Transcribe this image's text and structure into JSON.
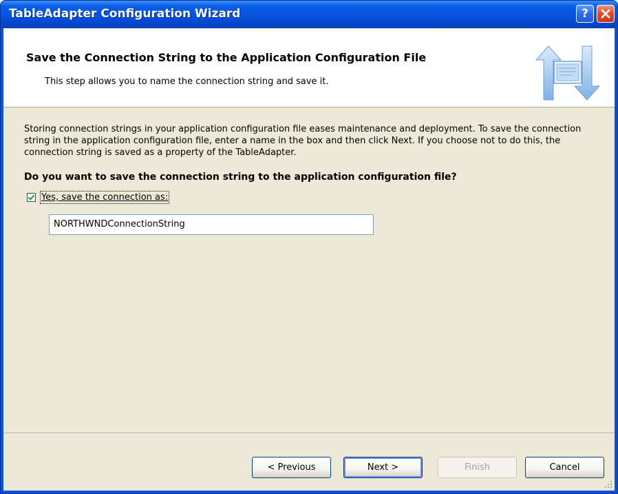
{
  "window": {
    "title": "TableAdapter Configuration Wizard",
    "help_label": "?"
  },
  "header": {
    "title": "Save the Connection String to the Application Configuration File",
    "subtitle": "This step allows you to name the connection string and save it."
  },
  "body": {
    "description": "Storing connection strings in your application configuration file eases maintenance and deployment. To save the connection string in the application configuration file, enter a name in the box and then click Next. If you choose not to do this, the connection string is saved as a property of the TableAdapter.",
    "question": "Do you want to save the connection string to the application configuration file?",
    "checkbox": {
      "label": "Yes, save the connection as:",
      "checked": true
    },
    "connection_name": "NORTHWNDConnectionString"
  },
  "buttons": {
    "previous": "< Previous",
    "next": "Next >",
    "finish": "Finish",
    "cancel": "Cancel"
  },
  "colors": {
    "titlebar": "#0553e0",
    "dialog_bg": "#ece9d8",
    "accent_green_check": "#21a121"
  },
  "icons": [
    "close-icon",
    "help-icon",
    "wizard-data-exchange-icon",
    "checkmark-icon",
    "resize-grip-icon"
  ]
}
